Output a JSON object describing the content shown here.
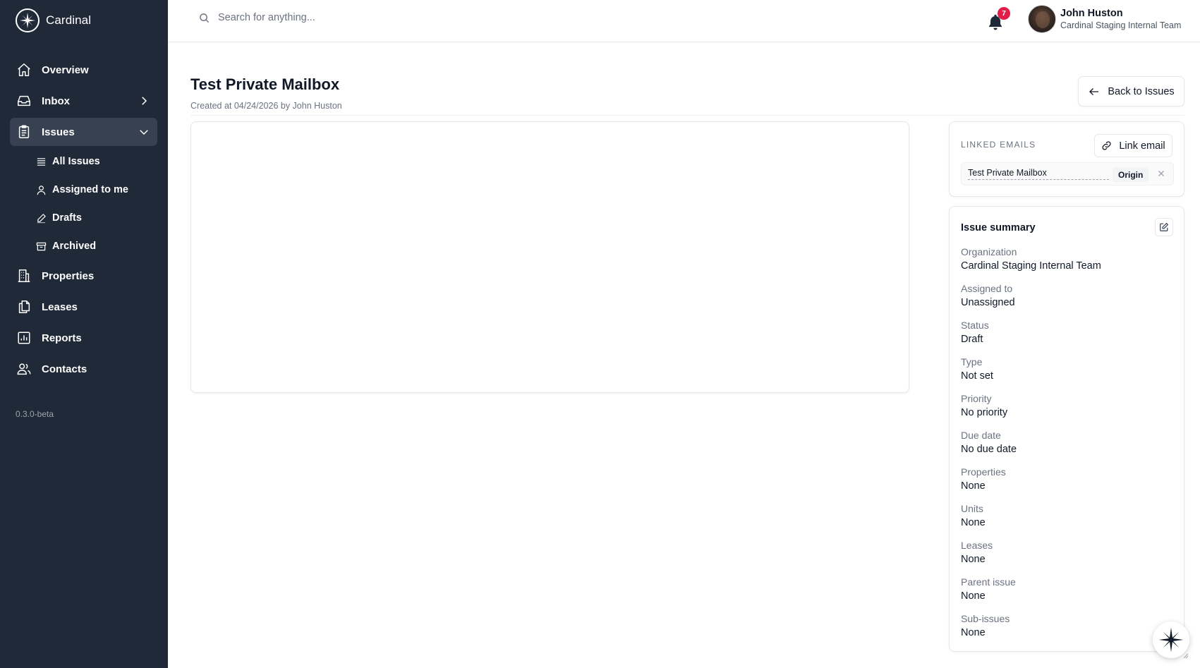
{
  "brand": {
    "name": "Cardinal"
  },
  "sidebar": {
    "items": [
      {
        "label": "Overview",
        "icon": "home-icon"
      },
      {
        "label": "Inbox",
        "icon": "inbox-icon"
      },
      {
        "label": "Issues",
        "icon": "clipboard-icon"
      },
      {
        "label": "Properties",
        "icon": "building-icon"
      },
      {
        "label": "Leases",
        "icon": "documents-icon"
      },
      {
        "label": "Reports",
        "icon": "bar-chart-icon"
      },
      {
        "label": "Contacts",
        "icon": "users-icon"
      }
    ],
    "issues_subitems": [
      {
        "label": "All Issues",
        "icon": "list-icon"
      },
      {
        "label": "Assigned to me",
        "icon": "user-icon"
      },
      {
        "label": "Drafts",
        "icon": "pencil-icon"
      },
      {
        "label": "Archived",
        "icon": "archive-icon"
      }
    ],
    "version": "0.3.0-beta"
  },
  "topbar": {
    "search_placeholder": "Search for anything...",
    "notification_count": "7",
    "user_name": "John Huston",
    "user_org": "Cardinal Staging Internal Team"
  },
  "page": {
    "title": "Test Private Mailbox",
    "meta": "Created at 04/24/2026 by John Huston",
    "back_label": "Back to Issues"
  },
  "linked_emails": {
    "label": "LINKED EMAILS",
    "link_button": "Link email",
    "items": [
      {
        "subject": "Test Private Mailbox",
        "badge": "Origin"
      }
    ]
  },
  "summary": {
    "title": "Issue summary",
    "fields": [
      {
        "label": "Organization",
        "value": "Cardinal Staging Internal Team"
      },
      {
        "label": "Assigned to",
        "value": "Unassigned"
      },
      {
        "label": "Status",
        "value": "Draft"
      },
      {
        "label": "Type",
        "value": "Not set"
      },
      {
        "label": "Priority",
        "value": "No priority"
      },
      {
        "label": "Due date",
        "value": "No due date"
      },
      {
        "label": "Properties",
        "value": "None"
      },
      {
        "label": "Units",
        "value": "None"
      },
      {
        "label": "Leases",
        "value": "None"
      },
      {
        "label": "Parent issue",
        "value": "None"
      },
      {
        "label": "Sub-issues",
        "value": "None"
      }
    ]
  },
  "colors": {
    "sidebar_bg": "#1f2937",
    "active_item_bg": "#374151",
    "badge": "#e11d48"
  }
}
